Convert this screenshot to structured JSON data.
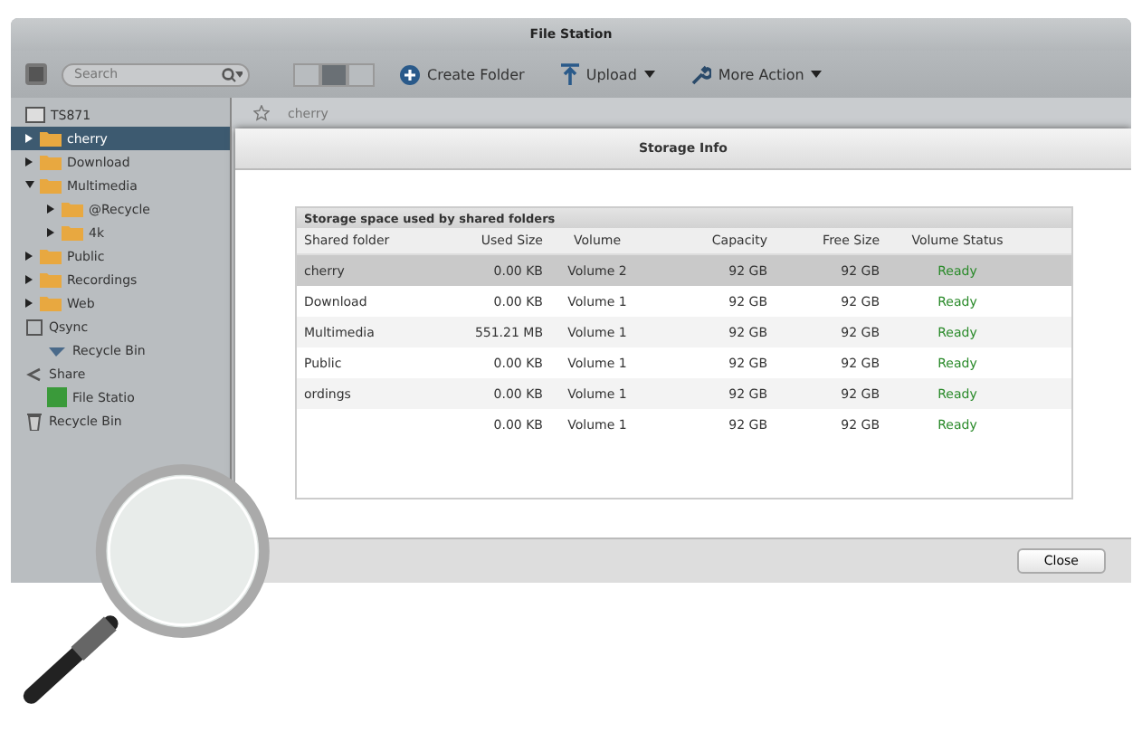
{
  "window": {
    "title": "File Station"
  },
  "toolbar": {
    "search": {
      "placeholder": "Search"
    },
    "views": [
      {
        "selected": false
      },
      {
        "selected": true
      },
      {
        "selected": false
      }
    ],
    "create_folder": "Create Folder",
    "upload": "Upload",
    "more_action": "More Action"
  },
  "sidebar": {
    "root": "TS871",
    "items": [
      {
        "label": "cherry",
        "kind": "folder",
        "selected": true,
        "expanded": false
      },
      {
        "label": "Download",
        "kind": "folder",
        "selected": false,
        "expanded": false
      },
      {
        "label": "Multimedia",
        "kind": "folder",
        "selected": false,
        "expanded": true,
        "children": [
          {
            "label": "@Recycle",
            "kind": "folder",
            "selected": false,
            "expanded": false
          },
          {
            "label": "4k",
            "kind": "folder",
            "selected": false,
            "expanded": false
          }
        ]
      },
      {
        "label": "Public",
        "kind": "folder",
        "selected": false,
        "expanded": false
      },
      {
        "label": "Recordings",
        "kind": "folder",
        "selected": false,
        "expanded": false
      },
      {
        "label": "Web",
        "kind": "folder",
        "selected": false,
        "expanded": false
      },
      {
        "label": "Qsync",
        "kind": "section",
        "selected": false,
        "children": [
          {
            "label": "Recycle Bin",
            "kind": "recycle",
            "selected": false
          }
        ]
      },
      {
        "label": "Share",
        "kind": "share",
        "selected": false,
        "children": [
          {
            "label": "File Statio",
            "kind": "app",
            "selected": false
          }
        ]
      },
      {
        "label": "Recycle Bin",
        "kind": "trash",
        "selected": false
      }
    ]
  },
  "breadcrumb": "cherry",
  "dialog": {
    "title": "Storage Info",
    "panel_title": "Storage space used by shared folders",
    "columns": [
      "Shared folder",
      "Used Size",
      "Volume",
      "Capacity",
      "Free Size",
      "Volume Status"
    ],
    "rows": [
      {
        "name": "cherry",
        "used": "0.00 KB",
        "volume": "Volume 2",
        "capacity": "92 GB",
        "free": "92 GB",
        "status": "Ready",
        "selected": true
      },
      {
        "name": "Download",
        "used": "0.00 KB",
        "volume": "Volume 1",
        "capacity": "92 GB",
        "free": "92 GB",
        "status": "Ready",
        "selected": false
      },
      {
        "name": "Multimedia",
        "used": "551.21 MB",
        "volume": "Volume 1",
        "capacity": "92 GB",
        "free": "92 GB",
        "status": "Ready",
        "selected": false
      },
      {
        "name": "Public",
        "used": "0.00 KB",
        "volume": "Volume 1",
        "capacity": "92 GB",
        "free": "92 GB",
        "status": "Ready",
        "selected": false
      },
      {
        "name": "ordings",
        "used": "0.00 KB",
        "volume": "Volume 1",
        "capacity": "92 GB",
        "free": "92 GB",
        "status": "Ready",
        "selected": false
      },
      {
        "used": "0.00 KB",
        "volume": "Volume 1",
        "capacity": "92 GB",
        "free": "92 GB",
        "status": "Ready",
        "selected": false
      }
    ],
    "close": "Close"
  }
}
